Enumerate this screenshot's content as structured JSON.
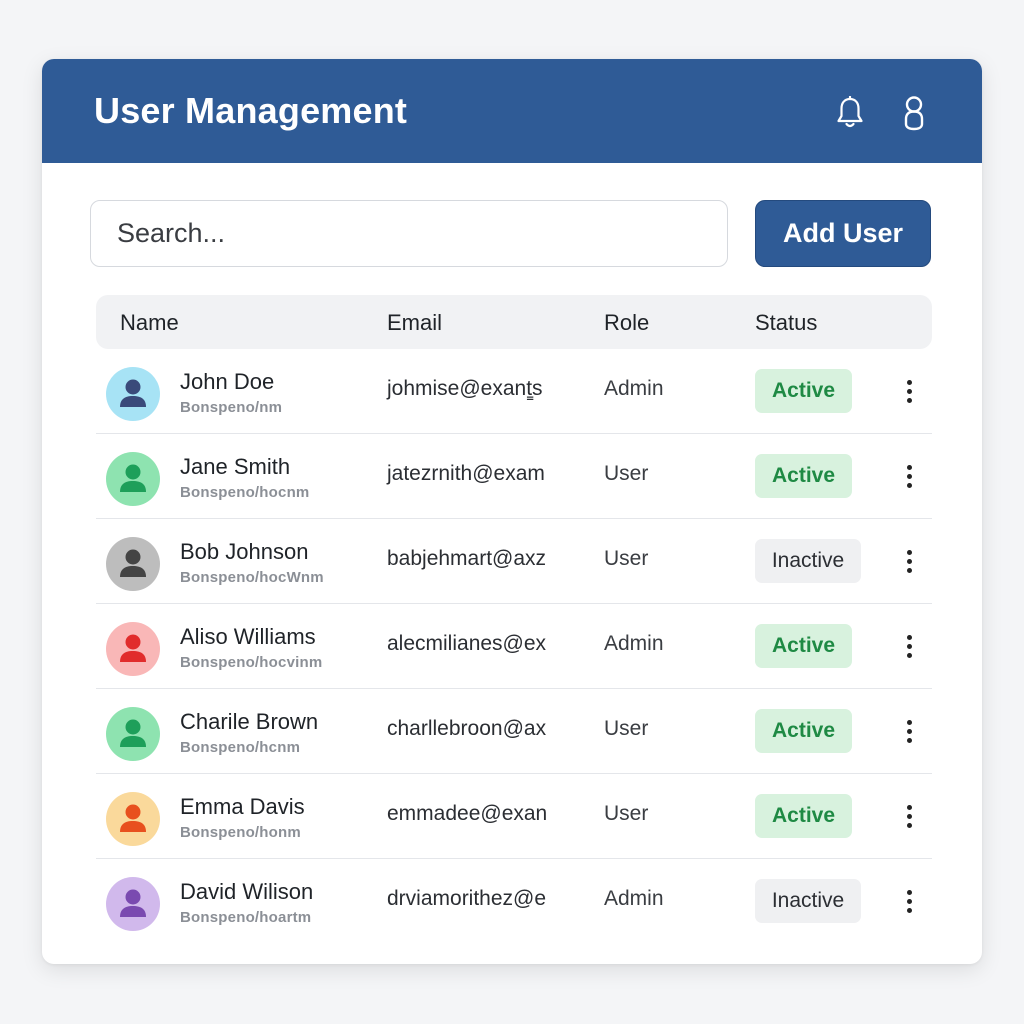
{
  "header": {
    "title": "User Management",
    "icons": [
      "bell-icon",
      "user-icon"
    ]
  },
  "toolbar": {
    "search_placeholder": "Search...",
    "add_label": "Add User"
  },
  "table": {
    "columns": [
      "Name",
      "Email",
      "Role",
      "Status"
    ],
    "rows": [
      {
        "name": "John Doe",
        "sub": "Bonspeno/nm",
        "email": "johmise@exant̳s",
        "role": "Admin",
        "status": "Active",
        "avatar_bg": "#a7e3f5",
        "avatar_fg": "#3a4a7a"
      },
      {
        "name": "Jane Smith",
        "sub": "Bonspeno/hocnm",
        "email": "jatezrnith@exam",
        "role": "User",
        "status": "Active",
        "avatar_bg": "#8ee3b0",
        "avatar_fg": "#1e9f5a"
      },
      {
        "name": "Bob Johnson",
        "sub": "Bonspeno/hocWnm",
        "email": "babjehmart@axz",
        "role": "User",
        "status": "Inactive",
        "avatar_bg": "#bdbdbd",
        "avatar_fg": "#444444"
      },
      {
        "name": "Aliso Williams",
        "sub": "Bonspeno/hocvinm",
        "email": "alecmilianes@ex",
        "role": "Admin",
        "status": "Active",
        "avatar_bg": "#f9b7b7",
        "avatar_fg": "#e12c2c"
      },
      {
        "name": "Charile Brown",
        "sub": "Bonspeno/hcnm",
        "email": "charllebroon@ax",
        "role": "User",
        "status": "Active",
        "avatar_bg": "#8ee3b0",
        "avatar_fg": "#1e9f5a"
      },
      {
        "name": "Emma Davis",
        "sub": "Bonspeno/honm",
        "email": "emmadee@exan",
        "role": "User",
        "status": "Active",
        "avatar_bg": "#fad99b",
        "avatar_fg": "#e8501e"
      },
      {
        "name": "David Wilison",
        "sub": "Bonspeno/hoartm",
        "email": "drviamorithez@e",
        "role": "Admin",
        "status": "Inactive",
        "avatar_bg": "#d1b9ec",
        "avatar_fg": "#7a4ab0"
      }
    ]
  },
  "colors": {
    "brand": "#2f5b96",
    "active_bg": "#d8f2de",
    "active_text": "#1f8a44",
    "inactive_bg": "#eff0f2"
  }
}
